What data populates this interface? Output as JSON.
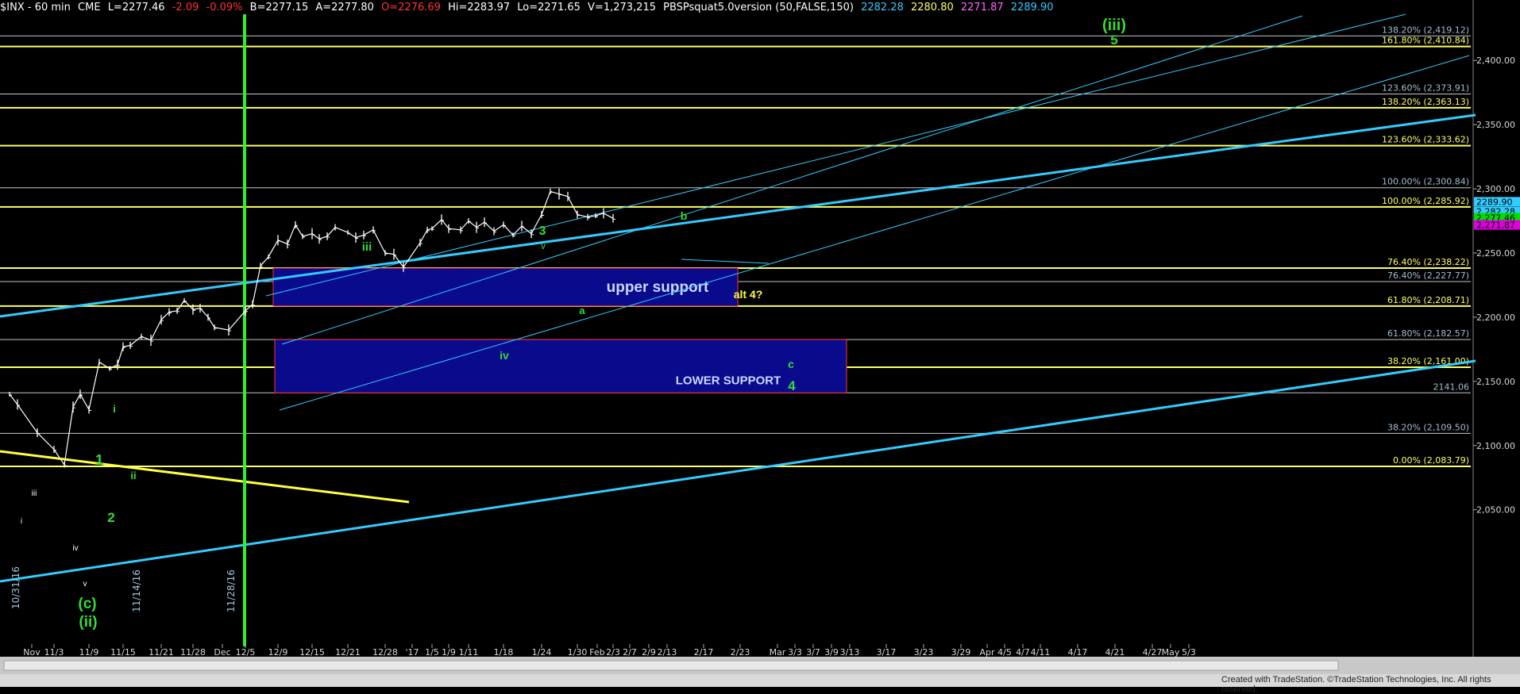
{
  "header": {
    "symbol": "$INX - 60 min",
    "exchange": "CME",
    "last": "L=2277.46",
    "chg": "-2.09",
    "pct": "-0.09%",
    "bid": "B=2277.15",
    "ask": "A=2277.80",
    "open": "O=2276.69",
    "hi": "Hi=2283.97",
    "lo": "Lo=2271.65",
    "vol": "V=1,273,215",
    "study": "PBSPsquat5.0version (50,FALSE,150)",
    "v1": "2282.28",
    "v2": "2280.80",
    "v3": "2271.87",
    "v4": "2289.90"
  },
  "colors": {
    "background": "#000000",
    "bars": "#ffffff",
    "fib_yellow": "#ffff66",
    "fib_white": "#c8c8c8",
    "channel_cyan": "#33ccff",
    "wave_green": "#33dd33",
    "box_fill": "#0a0a8c",
    "box_border": "#ff3333"
  },
  "footer": "Created with TradeStation. ©TradeStation Technologies, Inc. All rights reserved.",
  "chart_data": {
    "type": "ohlc",
    "ylim": [
      2020,
      2460
    ],
    "y_ticks": [
      "2,050.00",
      "2,100.00",
      "2,150.00",
      "2,200.00",
      "2,250.00",
      "2,300.00",
      "2,350.00",
      "2,400.00"
    ],
    "x_labels": [
      "Nov",
      "11/3",
      "11/9",
      "11/15",
      "11/21",
      "11/28",
      "Dec",
      "12/5",
      "12/9",
      "12/15",
      "12/21",
      "12/28",
      "'17",
      "1/5",
      "1/9",
      "1/11",
      "1/18",
      "1/24",
      "1/30",
      "Feb",
      "2/3",
      "2/7",
      "2/9",
      "2/13",
      "2/17",
      "2/23",
      "Mar",
      "3/3",
      "3/7",
      "3/9",
      "3/13",
      "3/17",
      "3/23",
      "3/29",
      "Apr",
      "4/5",
      "4/7",
      "4/11",
      "4/17",
      "4/21",
      "4/27",
      "May",
      "5/3"
    ],
    "fib_levels": [
      {
        "label": "138.20% (2,419.12)",
        "value": 2419.12,
        "color": "white"
      },
      {
        "label": "161.80% (2,410.84)",
        "value": 2410.84,
        "color": "yellow"
      },
      {
        "label": "123.60% (2,373.91)",
        "value": 2373.91,
        "color": "white"
      },
      {
        "label": "138.20% (2,363.13)",
        "value": 2363.13,
        "color": "yellow"
      },
      {
        "label": "123.60% (2,333.62)",
        "value": 2333.62,
        "color": "yellow"
      },
      {
        "label": "100.00% (2,300.84)",
        "value": 2300.84,
        "color": "white"
      },
      {
        "label": "100.00% (2,285.92)",
        "value": 2285.92,
        "color": "yellow"
      },
      {
        "label": "76.40% (2,238.22)",
        "value": 2238.22,
        "color": "yellow"
      },
      {
        "label": "76.40% (2,227.77)",
        "value": 2227.77,
        "color": "white"
      },
      {
        "label": "61.80% (2,208.71)",
        "value": 2208.71,
        "color": "yellow"
      },
      {
        "label": "61.80% (2,182.57)",
        "value": 2182.57,
        "color": "white"
      },
      {
        "label": "38.20% (2,161.00)",
        "value": 2161.0,
        "color": "yellow"
      },
      {
        "label": "2141.06",
        "value": 2141.06,
        "color": "white"
      },
      {
        "label": "38.20% (2,109.50)",
        "value": 2109.5,
        "color": "white"
      },
      {
        "label": "0.00% (2,083.79)",
        "value": 2083.79,
        "color": "yellow"
      }
    ],
    "price_flags": [
      {
        "value": 2289.9,
        "label": "2289.90",
        "bg": "#33ccff"
      },
      {
        "value": 2282.28,
        "label": "2,282.28",
        "bg": "#33ccff"
      },
      {
        "value": 2277.46,
        "label": "2,277.46",
        "bg": "#00dd00"
      },
      {
        "value": 2271.87,
        "label": "2,271.87",
        "bg": "#dd00dd"
      }
    ],
    "zones": [
      {
        "label": "upper support",
        "from_x": "12/9",
        "to_x": "2/23",
        "from_y": 2208.71,
        "to_y": 2238.22
      },
      {
        "label": "LOWER SUPPORT",
        "from_x": "12/9",
        "to_x": "3/13",
        "from_y": 2141.06,
        "to_y": 2182.57
      }
    ],
    "vertical_marker_x": "11/28",
    "date_stamps": [
      "10/31/16",
      "11/14/16",
      "11/28/16"
    ],
    "wave_labels": [
      "(iii)",
      "5",
      "iii",
      "3",
      "v",
      "b",
      "alt 4?",
      "a",
      "iv",
      "c",
      "4",
      "i",
      "1",
      "2",
      "ii",
      "i",
      "iii",
      "iv",
      "v",
      "(c)",
      "(ii)"
    ],
    "price_path": [
      [
        "10/31",
        2140
      ],
      [
        "11/1",
        2132
      ],
      [
        "11/2",
        2110
      ],
      [
        "11/3",
        2097
      ],
      [
        "11/4",
        2085
      ],
      [
        "11/7",
        2130
      ],
      [
        "11/8",
        2140
      ],
      [
        "11/9",
        2128
      ],
      [
        "11/10",
        2165
      ],
      [
        "11/11",
        2160
      ],
      [
        "11/14",
        2163
      ],
      [
        "11/15",
        2177
      ],
      [
        "11/16",
        2178
      ],
      [
        "11/17",
        2185
      ],
      [
        "11/18",
        2182
      ],
      [
        "11/21",
        2198
      ],
      [
        "11/22",
        2204
      ],
      [
        "11/23",
        2205
      ],
      [
        "11/25",
        2213
      ],
      [
        "11/28",
        2206
      ],
      [
        "11/29",
        2207
      ],
      [
        "11/30",
        2200
      ],
      [
        "12/1",
        2192
      ],
      [
        "12/2",
        2190
      ],
      [
        "12/5",
        2205
      ],
      [
        "12/6",
        2210
      ],
      [
        "12/7",
        2240
      ],
      [
        "12/8",
        2247
      ],
      [
        "12/9",
        2260
      ],
      [
        "12/12",
        2257
      ],
      [
        "12/13",
        2272
      ],
      [
        "12/14",
        2263
      ],
      [
        "12/15",
        2265
      ],
      [
        "12/16",
        2261
      ],
      [
        "12/19",
        2263
      ],
      [
        "12/20",
        2270
      ],
      [
        "12/21",
        2266
      ],
      [
        "12/22",
        2262
      ],
      [
        "12/23",
        2264
      ],
      [
        "12/27",
        2268
      ],
      [
        "12/28",
        2250
      ],
      [
        "12/29",
        2249
      ],
      [
        "12/30",
        2239
      ],
      [
        "1/3",
        2258
      ],
      [
        "1/4",
        2268
      ],
      [
        "1/5",
        2269
      ],
      [
        "1/6",
        2276
      ],
      [
        "1/9",
        2269
      ],
      [
        "1/10",
        2268
      ],
      [
        "1/11",
        2275
      ],
      [
        "1/12",
        2270
      ],
      [
        "1/13",
        2274
      ],
      [
        "1/17",
        2267
      ],
      [
        "1/18",
        2272
      ],
      [
        "1/19",
        2264
      ],
      [
        "1/20",
        2271
      ],
      [
        "1/23",
        2265
      ],
      [
        "1/24",
        2280
      ],
      [
        "1/25",
        2298
      ],
      [
        "1/26",
        2296
      ],
      [
        "1/27",
        2294
      ],
      [
        "1/30",
        2280
      ],
      [
        "1/31",
        2278
      ],
      [
        "2/1",
        2279
      ],
      [
        "2/2",
        2281
      ],
      [
        "2/3",
        2277
      ]
    ]
  }
}
